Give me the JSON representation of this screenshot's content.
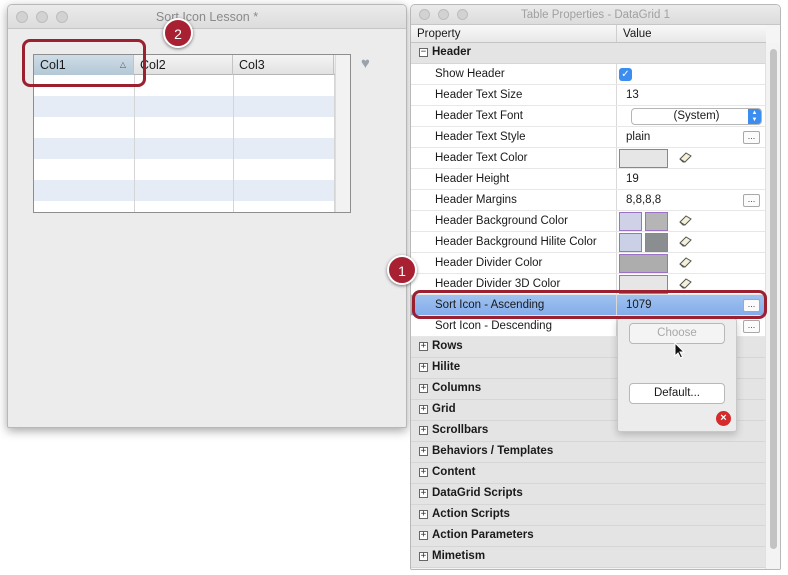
{
  "left_window": {
    "title": "Sort Icon Lesson *",
    "columns": [
      "Col1",
      "Col2",
      "Col3"
    ]
  },
  "right_window": {
    "title": "Table Properties - DataGrid 1",
    "col_property": "Property",
    "col_value": "Value",
    "header_group": {
      "expander": "⊟",
      "label": "Header"
    },
    "properties": [
      {
        "label": "Show Header",
        "value": "",
        "checked": true
      },
      {
        "label": "Header Text Size",
        "value": "13"
      },
      {
        "label": "Header Text Font",
        "value": "(System)"
      },
      {
        "label": "Header Text Style",
        "value": "plain"
      },
      {
        "label": "Header Text Color",
        "value": ""
      },
      {
        "label": "Header Height",
        "value": "19"
      },
      {
        "label": "Header Margins",
        "value": "8,8,8,8"
      },
      {
        "label": "Header Background Color",
        "value": ""
      },
      {
        "label": "Header Background Hilite Color",
        "value": ""
      },
      {
        "label": "Header Divider Color",
        "value": ""
      },
      {
        "label": "Header Divider 3D Color",
        "value": ""
      },
      {
        "label": "Sort Icon - Ascending",
        "value": "1079"
      },
      {
        "label": "Sort Icon - Descending",
        "value": ""
      }
    ],
    "groups": [
      "Rows",
      "Hilite",
      "Columns",
      "Grid",
      "Scrollbars",
      "Behaviors / Templates",
      "Content",
      "DataGrid Scripts",
      "Action Scripts",
      "Action Parameters",
      "Mimetism"
    ],
    "ellipsis": "...",
    "swatch_colors": {
      "text_color": "#e6e6e6",
      "bg_left": "#cfd1e6",
      "bg_right": "#b5b5b5",
      "hilite_left": "#cad1e6",
      "hilite_right": "#8a8e90",
      "divider": "#adadad",
      "divider3d": "#e6e6e6",
      "border": "#9b72c6"
    }
  },
  "popup_menu": {
    "choose_label": "Choose",
    "default_label": "Default..."
  },
  "annotations": {
    "badge1": "1",
    "badge2": "2"
  }
}
